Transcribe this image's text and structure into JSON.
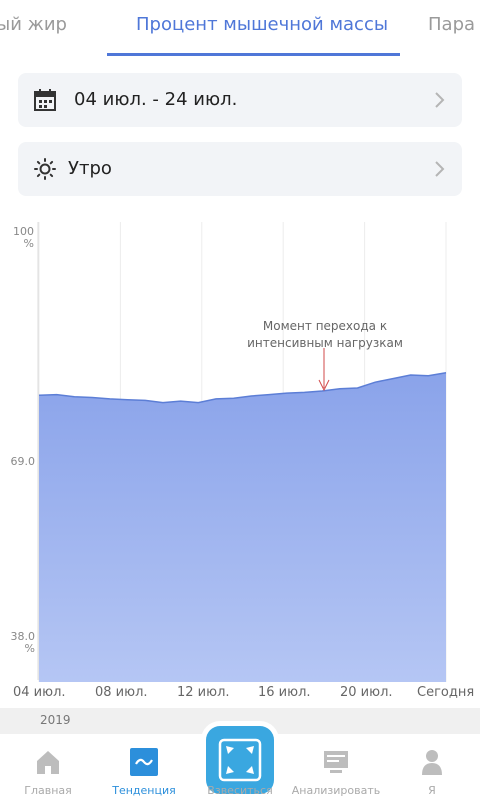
{
  "tabs": {
    "left": "ый жир",
    "center": "Процент мышечной массы",
    "right": "Пара"
  },
  "filters": {
    "date_range": "04 июл. - 24 июл.",
    "time_of_day": "Утро"
  },
  "chart_data": {
    "type": "area",
    "x": [
      "04 июл.",
      "08 июл.",
      "12 июл.",
      "16 июл.",
      "20 июл.",
      "Сегодня"
    ],
    "y_ticks": [
      "100\n%",
      "69.0",
      "38.0\n%"
    ],
    "ylim": [
      38.0,
      100
    ],
    "annotation": "Момент перехода к интенсивным нагрузкам",
    "series": [
      {
        "values": [
          77.5,
          77.6,
          77.3,
          77.2,
          77.0,
          76.9,
          76.8,
          76.5,
          76.7,
          76.5,
          77.0,
          77.1,
          77.4,
          77.6,
          77.8,
          77.9,
          78.1,
          78.4,
          78.5,
          79.3,
          79.8,
          80.3,
          80.2,
          80.6
        ]
      }
    ],
    "fill_color": "#8aa3ea",
    "line_color": "#5c7ed6"
  },
  "year": "2019",
  "nav": {
    "items": [
      {
        "label": "Главная",
        "icon": "home-icon"
      },
      {
        "label": "Тенденция",
        "icon": "trend-icon"
      },
      {
        "label": "Взвеситься",
        "icon": "scale-icon"
      },
      {
        "label": "Анализировать",
        "icon": "monitor-icon"
      },
      {
        "label": "Я",
        "icon": "person-icon"
      }
    ],
    "active_color": "#2c8fdb"
  }
}
